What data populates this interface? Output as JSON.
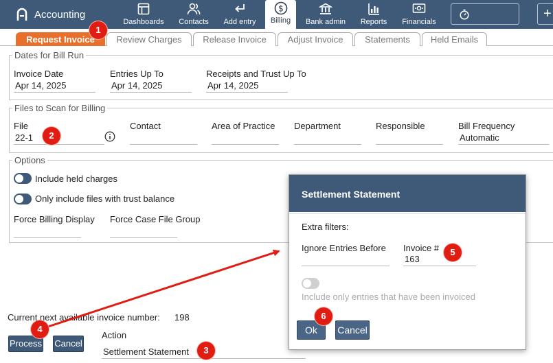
{
  "app": {
    "title": "Accounting"
  },
  "nav": [
    {
      "id": "dashboards",
      "label": "Dashboards",
      "icon": "dashboard-icon"
    },
    {
      "id": "contacts",
      "label": "Contacts",
      "icon": "contacts-icon"
    },
    {
      "id": "add_entry",
      "label": "Add entry",
      "icon": "add-entry-icon"
    },
    {
      "id": "billing",
      "label": "Billing",
      "icon": "dollar-icon",
      "active": true
    },
    {
      "id": "bank_admin",
      "label": "Bank admin",
      "icon": "bank-icon"
    },
    {
      "id": "reports",
      "label": "Reports",
      "icon": "reports-icon"
    },
    {
      "id": "financials",
      "label": "Financials",
      "icon": "financials-icon"
    }
  ],
  "tabs": [
    {
      "label": "Request Invoice",
      "active": true
    },
    {
      "label": "Review Charges"
    },
    {
      "label": "Release Invoice"
    },
    {
      "label": "Adjust Invoice"
    },
    {
      "label": "Statements"
    },
    {
      "label": "Held Emails"
    }
  ],
  "dates": {
    "legend": "Dates for Bill Run",
    "invoice_date_label": "Invoice Date",
    "invoice_date": "Apr 14, 2025",
    "entries_up_to_label": "Entries Up To",
    "entries_up_to": "Apr 14, 2025",
    "receipts_label": "Receipts and Trust Up To",
    "receipts": "Apr 14, 2025"
  },
  "files": {
    "legend": "Files to Scan for Billing",
    "file_label": "File",
    "file_value": "22-1",
    "contact_label": "Contact",
    "area_label": "Area of Practice",
    "department_label": "Department",
    "responsible_label": "Responsible",
    "bill_frequency_label": "Bill Frequency",
    "bill_frequency_value": "Automatic"
  },
  "options": {
    "legend": "Options",
    "held_charges": "Include held charges",
    "trust_balance": "Only include files with trust balance",
    "force_billing": "Force Billing Display",
    "force_case": "Force Case File Group"
  },
  "footer": {
    "next_invoice_label": "Current next available invoice number:",
    "next_invoice_value": "198",
    "process_label": "Process",
    "cancel_label": "Cancel",
    "action_label": "Action",
    "action_value": "Settlement Statement"
  },
  "modal": {
    "title": "Settlement Statement",
    "extra_filters": "Extra filters:",
    "ignore_before_label": "Ignore Entries Before",
    "invoice_num_label": "Invoice #",
    "invoice_num_value": "163",
    "only_invoiced": "Include only entries that have been invoiced",
    "ok_label": "Ok",
    "cancel_label": "Cancel"
  },
  "annotations": [
    "1",
    "2",
    "3",
    "4",
    "5",
    "6"
  ],
  "colors": {
    "nav_bg": "#3f5a78",
    "active_tab": "#e8702a",
    "badge": "#e01d12",
    "arrow": "#e01d12"
  }
}
